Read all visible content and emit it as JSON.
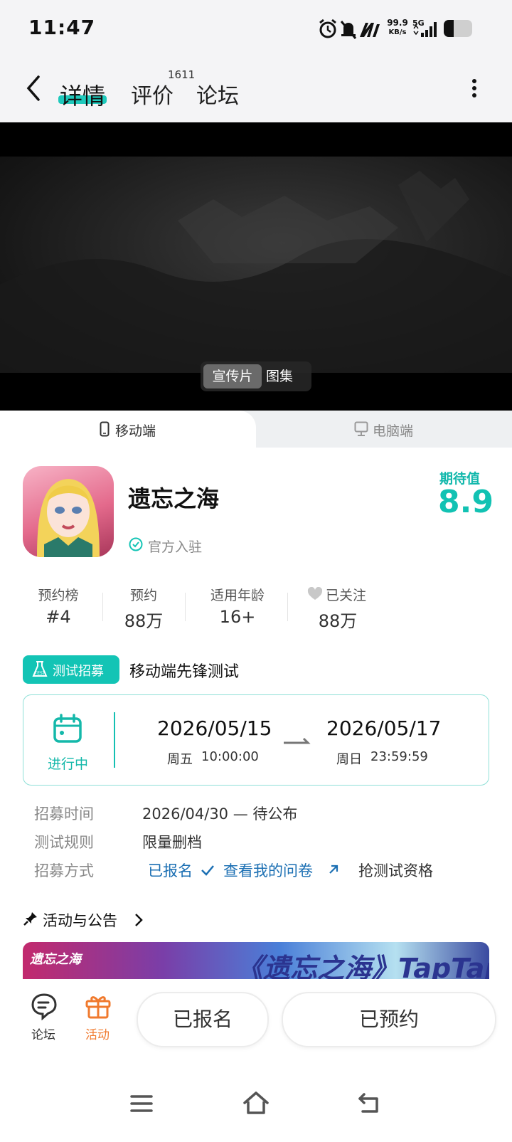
{
  "status_bar": {
    "time": "11:47",
    "network_speed_value": "99.9",
    "network_speed_unit": "KB/s",
    "network_type": "5G"
  },
  "nav": {
    "tabs": [
      {
        "label": "详情",
        "active": true
      },
      {
        "label": "评价",
        "active": false
      },
      {
        "label": "论坛",
        "active": false
      }
    ],
    "review_count": "1611"
  },
  "media": {
    "tabs": [
      "宣传片",
      "图集"
    ],
    "active": "宣传片"
  },
  "platform": {
    "tabs": [
      {
        "label": "移动端",
        "icon": "phone-icon",
        "active": true
      },
      {
        "label": "电脑端",
        "icon": "monitor-icon",
        "active": false
      }
    ]
  },
  "app": {
    "title": "遗忘之海",
    "official": "官方入驻",
    "expect_label": "期待值",
    "expect_value": "8.9"
  },
  "stats": [
    {
      "label": "预约榜",
      "value": "#4"
    },
    {
      "label": "预约",
      "value": "88万"
    },
    {
      "label": "适用年龄",
      "value": "16+"
    },
    {
      "label": "已关注",
      "value": "88万"
    }
  ],
  "recruit": {
    "badge": "测试招募",
    "badge_icon_text": "TEST",
    "title": "移动端先锋测试",
    "status": "进行中",
    "start_date": "2026/05/15",
    "start_day": "周五",
    "start_time": "10:00:00",
    "end_date": "2026/05/17",
    "end_day": "周日",
    "end_time": "23:59:59",
    "info": {
      "time_label": "招募时间",
      "time_value": "2026/04/30 — 待公布",
      "rules_label": "测试规则",
      "rules_value": "限量删档",
      "method_label": "招募方式",
      "signed_up": "已报名",
      "view_survey": "查看我的问卷",
      "grab": "抢测试资格"
    }
  },
  "activities": {
    "title": "活动与公告",
    "banner_text": "《遗忘之海》TapTap",
    "banner_logo": "遗忘之海"
  },
  "bottom_bar": {
    "forum_label": "论坛",
    "activity_label": "活动",
    "signed_button": "已报名",
    "reserved_button": "已预约"
  },
  "colors": {
    "accent": "#13c4b5",
    "activity_orange": "#f07a2e",
    "link": "#1b6fb3"
  }
}
